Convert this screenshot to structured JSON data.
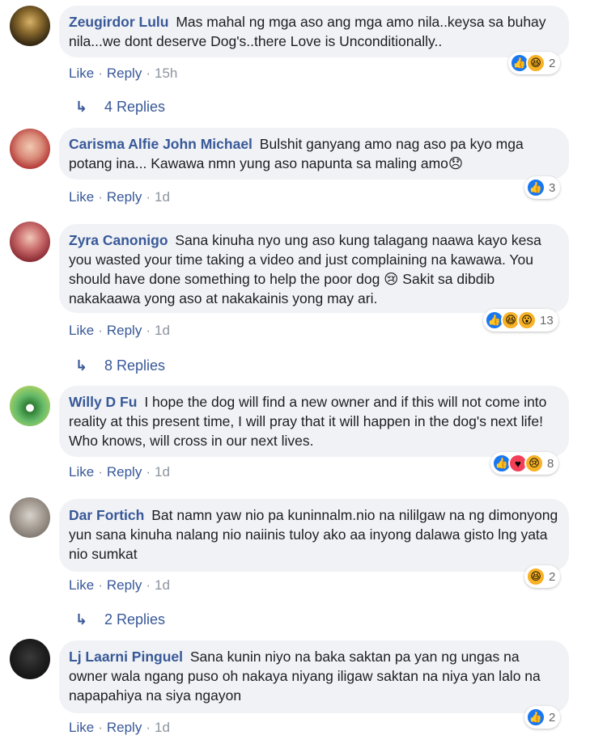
{
  "comments": [
    {
      "author": "Zeugirdor Lulu",
      "text": "Mas mahal ng mga aso ang mga amo nila..keysa sa buhay nila...we dont deserve Dog's..there Love is Unconditionally..",
      "like": "Like",
      "reply": "Reply",
      "time": "15h",
      "reaction_count": "2",
      "reactions": [
        "like",
        "haha"
      ],
      "replies": "4 Replies"
    },
    {
      "author": "Carisma Alfie John Michael",
      "text": "Bulshit ganyang amo nag aso pa kyo mga potang ina... Kawawa nmn yung aso napunta sa maling amo😞",
      "like": "Like",
      "reply": "Reply",
      "time": "1d",
      "reaction_count": "3",
      "reactions": [
        "like"
      ]
    },
    {
      "author": "Zyra Canonigo",
      "text": "Sana kinuha nyo ung aso kung talagang naawa kayo kesa you wasted your time taking a video and just complaining na kawawa. You should have done something to help the poor dog 😢 Sakit sa dibdib nakakaawa yong aso at nakakainis yong may ari.",
      "like": "Like",
      "reply": "Reply",
      "time": "1d",
      "reaction_count": "13",
      "reactions": [
        "like",
        "haha",
        "wow"
      ],
      "replies": "8 Replies"
    },
    {
      "author": "Willy D Fu",
      "text": "I hope the dog will find a new owner and if this will not come into reality at this present time, I will pray that it will happen in the dog's next life! Who knows, will cross in our next lives.",
      "like": "Like",
      "reply": "Reply",
      "time": "1d",
      "reaction_count": "8",
      "reactions": [
        "like",
        "love",
        "sad"
      ]
    },
    {
      "author": "Dar Fortich",
      "text": "Bat namn yaw nio pa kuninnalm.nio na nililgaw na ng dimonyong yun sana kinuha nalang nio naiinis tuloy ako aa inyong dalawa gisto lng yata nio sumkat",
      "like": "Like",
      "reply": "Reply",
      "time": "1d",
      "reaction_count": "2",
      "reactions": [
        "haha"
      ],
      "replies": "2 Replies"
    },
    {
      "author": "Lj Laarni Pinguel",
      "text": "Sana kunin niyo na baka saktan pa yan ng ungas na owner wala ngang puso oh nakaya niyang iligaw saktan na niya yan lalo na napapahiya na siya ngayon",
      "like": "Like",
      "reply": "Reply",
      "time": "1d",
      "reaction_count": "2",
      "reactions": [
        "like"
      ]
    }
  ],
  "colors": {
    "link": "#385898",
    "bubble": "#f0f2f5",
    "like": "#1877f2",
    "haha": "#f7b125",
    "love": "#f33e58"
  },
  "icons": {
    "like": "thumbs-up-icon",
    "haha": "laughing-face-icon",
    "wow": "surprised-face-icon",
    "sad": "crying-face-icon",
    "love": "heart-icon",
    "reply_arrow": "reply-arrow-icon"
  }
}
